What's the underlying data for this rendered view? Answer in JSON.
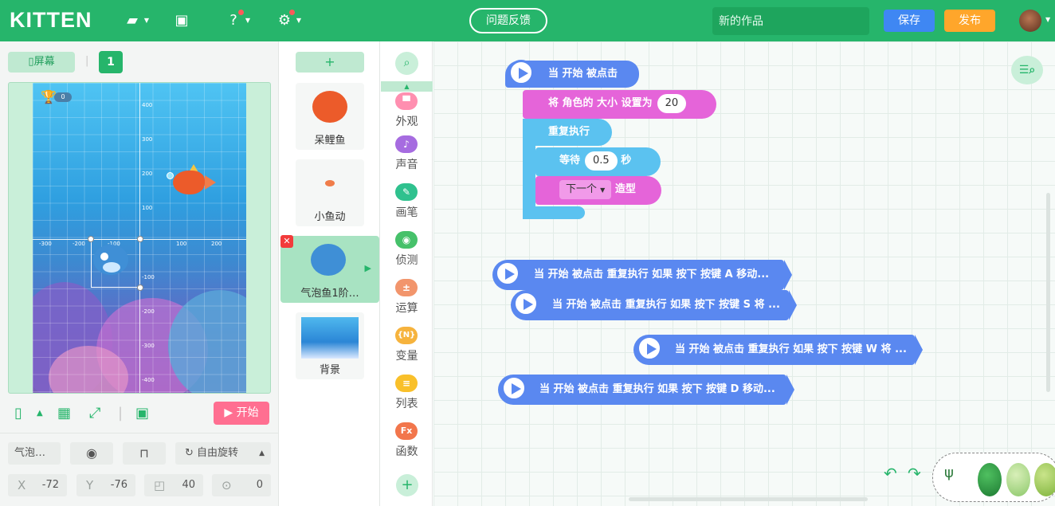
{
  "app": {
    "logo": "KITTEN"
  },
  "topbar": {
    "feedback_label": "问题反馈",
    "title_placeholder": "新的作品",
    "save_label": "保存",
    "publish_label": "发布"
  },
  "stage": {
    "screen_label": "屏幕",
    "screen_number": "1",
    "score": "0",
    "x_ticks": [
      "-300",
      "-200",
      "-100",
      "100",
      "200"
    ],
    "y_ticks": [
      "400",
      "300",
      "200",
      "100",
      "-100",
      "-200",
      "-300",
      "-400"
    ],
    "start_label": "开始"
  },
  "props": {
    "name": "气泡…",
    "rotation": "自由旋转",
    "x_label": "X",
    "x_value": "-72",
    "y_label": "Y",
    "y_value": "-76",
    "size_value": "40",
    "direction_value": "0"
  },
  "sprites": {
    "add_label": "+",
    "items": [
      {
        "name": "呆鲤鱼"
      },
      {
        "name": "小鱼动"
      },
      {
        "name": "气泡鱼1阶…"
      },
      {
        "name": "背景"
      }
    ]
  },
  "categories": [
    {
      "label": "外观",
      "icon": "looks-icon",
      "color": "#ff8fb0",
      "glyph": "▀"
    },
    {
      "label": "声音",
      "icon": "music-icon",
      "color": "#a66ce0",
      "glyph": "♪"
    },
    {
      "label": "画笔",
      "icon": "pen-icon",
      "color": "#2fc18e",
      "glyph": "✎"
    },
    {
      "label": "侦测",
      "icon": "sensing-icon",
      "color": "#46c16a",
      "glyph": "◉"
    },
    {
      "label": "运算",
      "icon": "operators-icon",
      "color": "#f2956c",
      "glyph": "±"
    },
    {
      "label": "变量",
      "icon": "variables-icon",
      "color": "#f6b33d",
      "glyph": "{N}"
    },
    {
      "label": "列表",
      "icon": "list-icon",
      "color": "#f9c02a",
      "glyph": "≡"
    },
    {
      "label": "函数",
      "icon": "function-icon",
      "color": "#f2764c",
      "glyph": "Fx"
    }
  ],
  "script": {
    "hat_label": "当 开始 被点击",
    "set_size_label": "将 角色的 大小 设置为",
    "set_size_value": "20",
    "repeat_label": "重复执行",
    "wait_label": "等待",
    "wait_value": "0.5",
    "wait_unit": "秒",
    "next_costume_option": "下一个",
    "costume_label": "造型"
  },
  "collapsed_scripts": [
    {
      "label": "当 开始 被点击 重复执行 如果 按下 按键 A 移动..."
    },
    {
      "label": "当 开始 被点击 重复执行 如果 按下 按键 S 将 ..."
    },
    {
      "label": "当 开始 被点击 重复执行 如果 按下 按键 W 将 ..."
    },
    {
      "label": "当 开始 被点击 重复执行 如果 按下 按键 D 移动..."
    }
  ],
  "colors": {
    "brand_green": "#26b56b",
    "save_blue": "#3f87f3",
    "publish_orange": "#ffa62b",
    "event_blue": "#5a88f0",
    "looks_pink": "#e564d9",
    "control_cyan": "#5bc2f0",
    "start_pink": "#ff6f91"
  }
}
